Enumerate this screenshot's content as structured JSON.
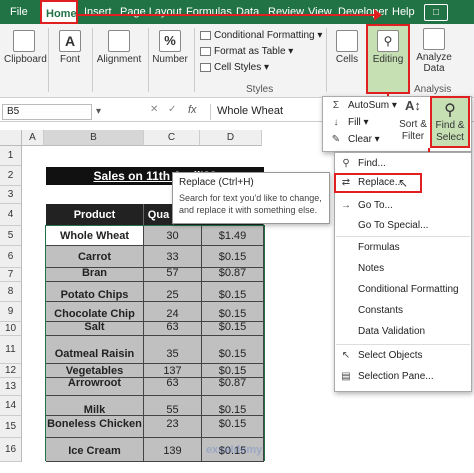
{
  "tabs": [
    {
      "label": "File",
      "active": false
    },
    {
      "label": "Home",
      "active": true
    },
    {
      "label": "Insert",
      "active": false
    },
    {
      "label": "Page Layout",
      "active": false
    },
    {
      "label": "Formulas",
      "active": false
    },
    {
      "label": "Data",
      "active": false
    },
    {
      "label": "Review",
      "active": false
    },
    {
      "label": "View",
      "active": false
    },
    {
      "label": "Developer",
      "active": false
    },
    {
      "label": "Help",
      "active": false
    }
  ],
  "ribbon": {
    "clipboard": "Clipboard",
    "font": "Font",
    "alignment": "Alignment",
    "number": "Number",
    "styles": {
      "conditional_formatting": "Conditional Formatting",
      "format_as_table": "Format as Table",
      "cell_styles": "Cell Styles",
      "group_label": "Styles"
    },
    "cells": "Cells",
    "editing": "Editing",
    "analyze_data": "Analyze Data",
    "analysis_group": "Analysis"
  },
  "editing_menu": {
    "autosum": "AutoSum",
    "fill": "Fill",
    "clear": "Clear",
    "sort_filter": "Sort & Filter",
    "find_select": "Find & Select"
  },
  "find_menu": {
    "items": [
      "Find...",
      "Replace...",
      "Go To...",
      "Go To Special...",
      "Formulas",
      "Notes",
      "Conditional Formatting",
      "Constants",
      "Data Validation",
      "Select Objects",
      "Selection Pane..."
    ]
  },
  "tooltip": {
    "title": "Replace (Ctrl+H)",
    "desc": "Search for text you'd like to change, and replace it with something else."
  },
  "formula_bar": {
    "name_box": "B5",
    "fx": "fx",
    "value": "Whole Wheat"
  },
  "columns": [
    "A",
    "B",
    "C",
    "D"
  ],
  "rows": [
    "1",
    "2",
    "3",
    "4",
    "5",
    "6",
    "7",
    "8",
    "9",
    "10",
    "11",
    "12",
    "13",
    "14",
    "15",
    "16"
  ],
  "sheet": {
    "title": "Sales on 11th April'22",
    "headers": [
      "Product",
      "Qua",
      ""
    ],
    "data": [
      {
        "product": "Whole Wheat",
        "qty": "30",
        "price": "$1.49"
      },
      {
        "product": "Carrot",
        "qty": "33",
        "price": "$0.15"
      },
      {
        "product": "Bran",
        "qty": "57",
        "price": "$0.87"
      },
      {
        "product": "Potato Chips",
        "qty": "25",
        "price": "$0.15"
      },
      {
        "product": "Chocolate Chip",
        "qty": "24",
        "price": "$0.15"
      },
      {
        "product": "Salt",
        "qty": "63",
        "price": "$0.15"
      },
      {
        "product": "Oatmeal Raisin",
        "qty": "35",
        "price": "$0.15"
      },
      {
        "product": "Vegetables",
        "qty": "137",
        "price": "$0.15"
      },
      {
        "product": "Arrowroot",
        "qty": "63",
        "price": "$0.87"
      },
      {
        "product": "Milk",
        "qty": "55",
        "price": "$0.15"
      },
      {
        "product": "Boneless Chicken",
        "qty": "23",
        "price": "$0.15"
      },
      {
        "product": "Ice Cream",
        "qty": "139",
        "price": "$0.15"
      }
    ]
  },
  "watermark": "exceldemy",
  "colors": {
    "excel_green": "#217346",
    "highlight_red": "#e02020",
    "selection_green": "#c6e0b4"
  }
}
